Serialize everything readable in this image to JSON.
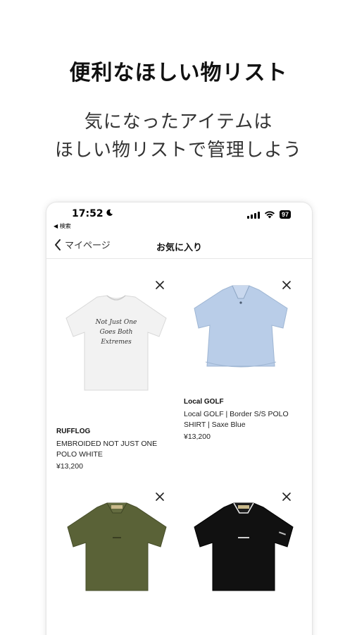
{
  "promo": {
    "headline": "便利なほしい物リスト",
    "sub_line1": "気になったアイテムは",
    "sub_line2": "ほしい物リストで管理しよう"
  },
  "status_bar": {
    "time": "17:52",
    "back_app": "◀ 検索",
    "battery": "97"
  },
  "nav": {
    "back_label": "マイページ",
    "title": "お気に入り"
  },
  "products": [
    {
      "brand": "RUFFLOG",
      "name_line1": "EMBROIDED NOT JUST ONE",
      "name_line2": "POLO WHITE",
      "price": "¥13,200",
      "color": "#f2f2f2",
      "print_text": "Not Just One Goes Both Extremes"
    },
    {
      "brand": "Local GOLF",
      "name_line1": "Local GOLF | Border S/S POLO",
      "name_line2": "SHIRT | Saxe Blue",
      "price": "¥13,200",
      "color": "#b9cde8"
    },
    {
      "brand": "",
      "name_line1": "",
      "name_line2": "",
      "price": "",
      "color": "#5a6237"
    },
    {
      "brand": "",
      "name_line1": "",
      "name_line2": "",
      "price": "",
      "color": "#111111"
    }
  ]
}
